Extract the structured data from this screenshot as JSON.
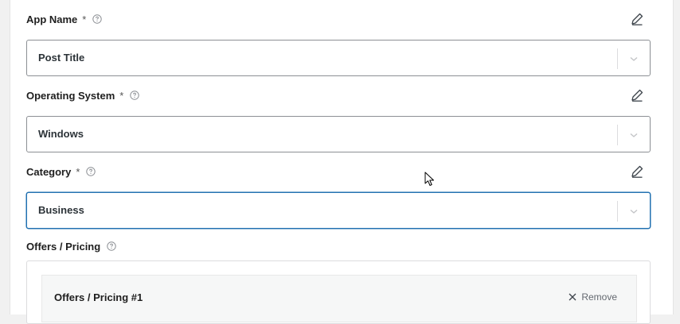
{
  "fields": [
    {
      "label": "App Name",
      "required_mark": "*",
      "value": "Post Title"
    },
    {
      "label": "Operating System",
      "required_mark": "*",
      "value": "Windows"
    },
    {
      "label": "Category",
      "required_mark": "*",
      "value": "Business"
    }
  ],
  "offers": {
    "label": "Offers / Pricing",
    "items": [
      {
        "title": "Offers / Pricing #1",
        "remove_label": "Remove"
      }
    ]
  },
  "icons": {
    "help": "question-circle-icon",
    "edit": "pencil-edit-icon",
    "dropdown": "chevron-down-icon",
    "remove": "close-x-icon"
  },
  "colors": {
    "focus_border": "#2271b1",
    "input_border": "#8c8f94",
    "label_text": "#1e1e1e",
    "muted_text": "#646970"
  }
}
